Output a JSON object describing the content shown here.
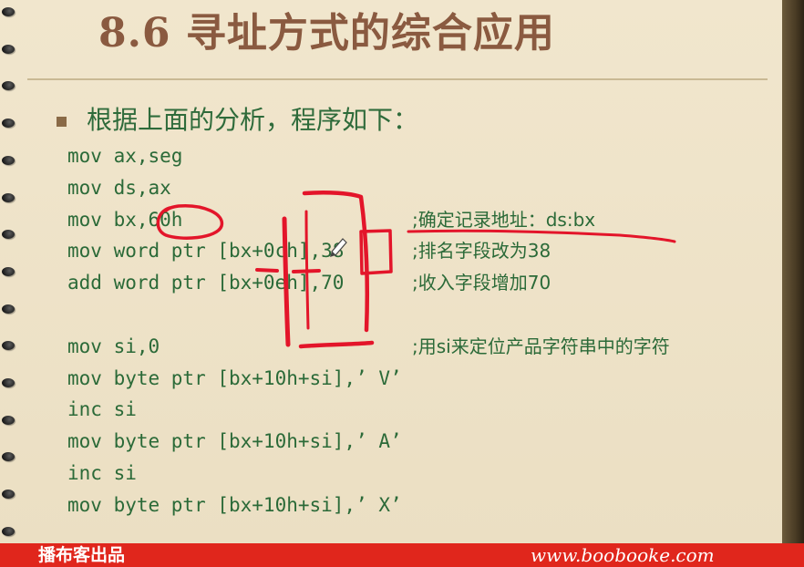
{
  "slide": {
    "title": "8.6 寻址方式的综合应用",
    "heading": "根据上面的分析，程序如下："
  },
  "code": {
    "lines": [
      "mov ax,seg",
      "mov ds,ax",
      "mov bx,60h",
      "mov word ptr [bx+0ch],38",
      "add word ptr [bx+0eh],70",
      "",
      "mov si,0",
      "mov byte ptr [bx+10h+si],’ V’",
      "inc si",
      "mov byte ptr [bx+10h+si],’ A’",
      "inc si",
      "mov byte ptr [bx+10h+si],’ X’"
    ],
    "comments": {
      "bx": ";确定记录地址：ds:bx",
      "rank": ";排名字段改为38",
      "income": ";收入字段增加70",
      "si": ";用si来定位产品字符串中的字符"
    }
  },
  "footer": {
    "brand": "播布客出品",
    "url": "www.boobooke.com"
  },
  "colors": {
    "title": "#8a5a40",
    "text": "#2b6a38",
    "annotation": "#e3152a",
    "footer": "#e0261c"
  }
}
